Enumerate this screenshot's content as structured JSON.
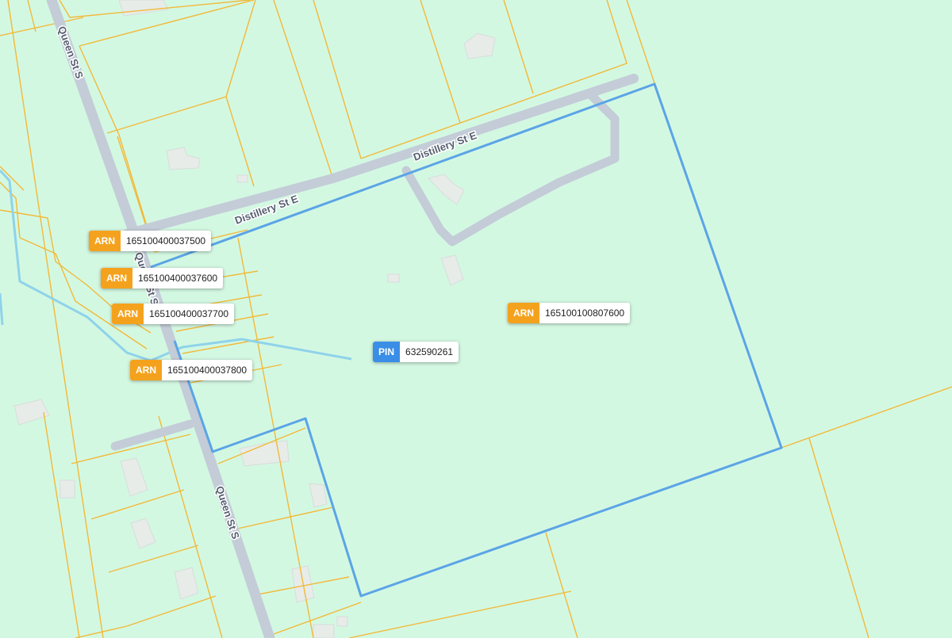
{
  "map": {
    "streets": [
      {
        "id": "queen-st-s-north",
        "name": "Queen St S"
      },
      {
        "id": "queen-st-s-mid",
        "name": "Queen St S"
      },
      {
        "id": "queen-st-s-south",
        "name": "Queen St S"
      },
      {
        "id": "distillery-st-e-east",
        "name": "Distillery St E"
      },
      {
        "id": "distillery-st-e-west",
        "name": "Distillery St E"
      }
    ],
    "colors": {
      "land": "#d3f8e2",
      "road": "#c4ccd8",
      "road_label_text": "#555f70",
      "parcel_line": "#f2b938",
      "selected_parcel_outline": "#5ba4e6",
      "stream": "#8fd3ea",
      "building": "#e7ece9",
      "arn_badge": "#f4a21d",
      "pin_badge": "#3a8ee6"
    }
  },
  "labels": [
    {
      "id": "arn-1",
      "type_label": "ARN",
      "value": "165100400037500"
    },
    {
      "id": "arn-2",
      "type_label": "ARN",
      "value": "165100400037600"
    },
    {
      "id": "arn-3",
      "type_label": "ARN",
      "value": "165100400037700"
    },
    {
      "id": "arn-4",
      "type_label": "ARN",
      "value": "165100400037800"
    },
    {
      "id": "arn-5",
      "type_label": "ARN",
      "value": "165100100807600"
    },
    {
      "id": "pin-1",
      "type_label": "PIN",
      "value": "632590261"
    }
  ]
}
